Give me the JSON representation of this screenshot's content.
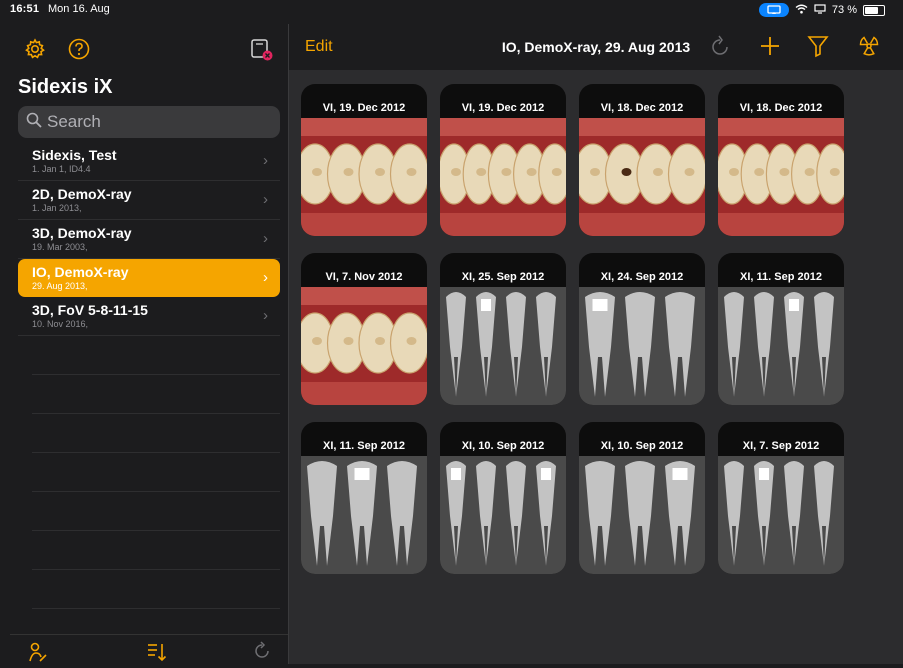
{
  "status": {
    "time": "16:51",
    "date": "Mon 16. Aug",
    "battery": "73 %",
    "battery_level": 0.73
  },
  "sidebar": {
    "title": "Sidexis iX",
    "search_placeholder": "Search",
    "patients": [
      {
        "name": "Sidexis, Test",
        "sub": "1. Jan 1, ID4.4",
        "selected": false
      },
      {
        "name": "2D, DemoX-ray",
        "sub": "1. Jan 2013,",
        "selected": false
      },
      {
        "name": "3D, DemoX-ray",
        "sub": "19. Mar 2003,",
        "selected": false
      },
      {
        "name": "IO, DemoX-ray",
        "sub": "29. Aug 2013,",
        "selected": true
      },
      {
        "name": "3D, FoV 5-8-11-15",
        "sub": "10. Nov 2016,",
        "selected": false
      }
    ],
    "bottom_icons": [
      "user-edit-icon",
      "sort-icon",
      "refresh-icon"
    ]
  },
  "topbar": {
    "edit_label": "Edit",
    "title": "IO, DemoX-ray, 29. Aug 2013",
    "icons": [
      "refresh-icon",
      "add-icon",
      "filter-icon",
      "radiation-icon"
    ]
  },
  "accent_color": "#f5a500",
  "images": [
    {
      "label": "VI, 19. Dec 2012",
      "kind": "photo"
    },
    {
      "label": "VI, 19. Dec 2012",
      "kind": "photo"
    },
    {
      "label": "VI, 18. Dec 2012",
      "kind": "photo"
    },
    {
      "label": "VI, 18. Dec 2012",
      "kind": "photo"
    },
    {
      "label": "VI, 7. Nov 2012",
      "kind": "photo"
    },
    {
      "label": "XI, 25. Sep 2012",
      "kind": "xray"
    },
    {
      "label": "XI, 24. Sep 2012",
      "kind": "xray"
    },
    {
      "label": "XI, 11. Sep 2012",
      "kind": "xray"
    },
    {
      "label": "XI, 11. Sep 2012",
      "kind": "xray"
    },
    {
      "label": "XI, 10. Sep 2012",
      "kind": "xray"
    },
    {
      "label": "XI, 10. Sep 2012",
      "kind": "xray"
    },
    {
      "label": "XI, 7. Sep 2012",
      "kind": "xray"
    }
  ]
}
